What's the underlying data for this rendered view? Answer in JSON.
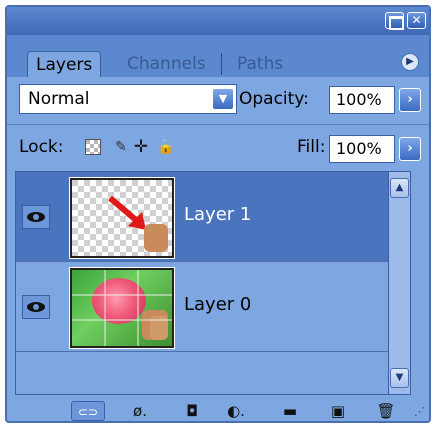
{
  "window": {
    "close_glyph": "✕"
  },
  "tabs": [
    {
      "label": "Layers"
    },
    {
      "label": "Channels"
    },
    {
      "label": "Paths"
    }
  ],
  "blend": {
    "mode": "Normal",
    "opacity_label": "Opacity:",
    "opacity_value": "100%"
  },
  "lock": {
    "label": "Lock:",
    "icons": [
      "transparency-lock-icon",
      "brush-lock-icon",
      "move-lock-icon",
      "padlock-icon"
    ],
    "fill_label": "Fill:",
    "fill_value": "100%"
  },
  "layers": [
    {
      "name": "Layer 1",
      "visible": true,
      "selected": true
    },
    {
      "name": "Layer 0",
      "visible": true,
      "selected": false
    }
  ],
  "colors": {
    "panel": "#7ea6e0",
    "selected_row": "#4a74bd",
    "titlebar": "#3e68b4"
  }
}
